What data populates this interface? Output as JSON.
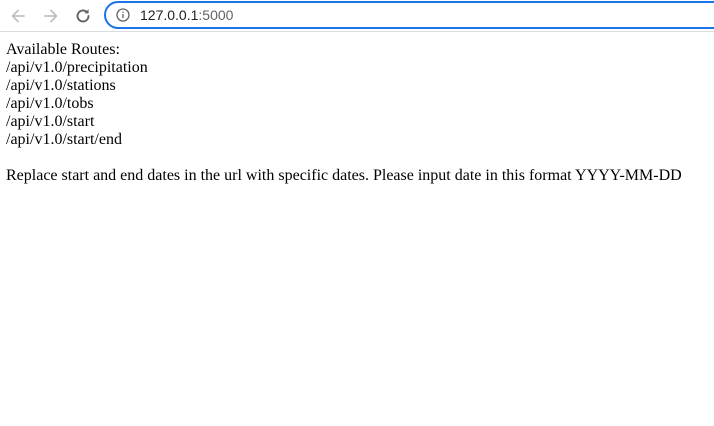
{
  "browser": {
    "url_host": "127.0.0.1",
    "url_port": ":5000"
  },
  "page": {
    "heading": "Available Routes:",
    "routes": [
      "/api/v1.0/precipitation",
      "/api/v1.0/stations",
      "/api/v1.0/tobs",
      "/api/v1.0/start",
      "/api/v1.0/start/end"
    ],
    "note": "Replace start and end dates in the url with specific dates. Please input date in this format YYYY-MM-DD"
  },
  "colors": {
    "omnibox_border": "#1a73e8",
    "nav_icon": "#5f6368",
    "nav_icon_disabled": "#bdc1c6"
  }
}
